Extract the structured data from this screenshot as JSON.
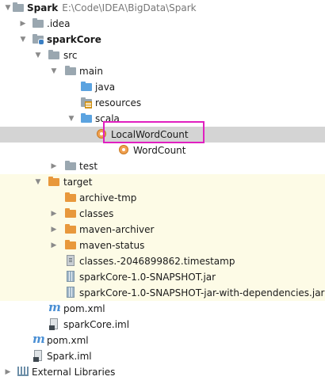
{
  "tree": {
    "root_name": "Spark",
    "root_path": "E:\\Code\\IDEA\\BigData\\Spark",
    "idea": ".idea",
    "module": "sparkCore",
    "src": "src",
    "main": "main",
    "java": "java",
    "resources": "resources",
    "scala": "scala",
    "local_word_count": "LocalWordCount",
    "word_count": "WordCount",
    "test": "test",
    "target": "target",
    "archive_tmp": "archive-tmp",
    "classes": "classes",
    "maven_archiver": "maven-archiver",
    "maven_status": "maven-status",
    "timestamp_file": "classes.-2046899862.timestamp",
    "jar": "sparkCore-1.0-SNAPSHOT.jar",
    "jar_deps": "sparkCore-1.0-SNAPSHOT-jar-with-dependencies.jar",
    "module_pom": "pom.xml",
    "module_iml": "sparkCore.iml",
    "root_pom": "pom.xml",
    "root_iml": "Spark.iml",
    "external_libraries": "External Libraries"
  },
  "colors": {
    "selection": "#d4d4d4",
    "excluded_bg": "#fdfbe6",
    "highlight_box": "#e020c0"
  }
}
